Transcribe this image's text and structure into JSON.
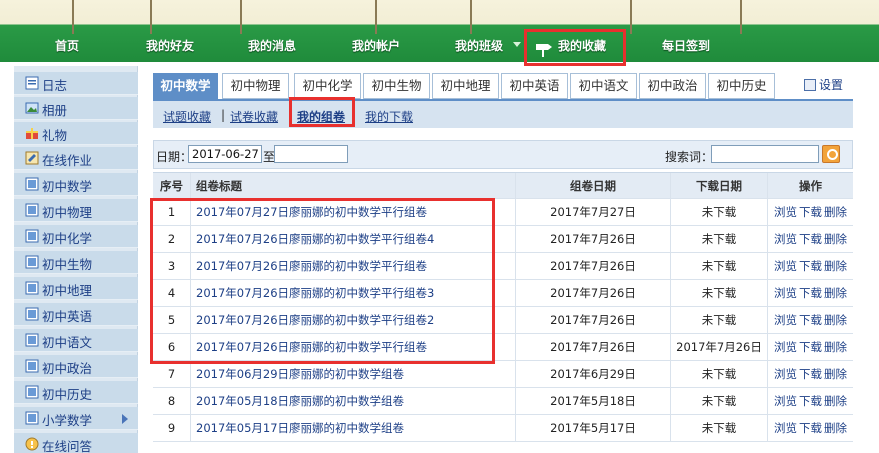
{
  "nav": {
    "items": [
      "首页",
      "我的好友",
      "我的消息",
      "我的帐户",
      "我的班级",
      "我的收藏",
      "每日签到"
    ],
    "active": "我的收藏"
  },
  "sidebar": {
    "items": [
      {
        "label": "日志",
        "icon": "journal-icon"
      },
      {
        "label": "相册",
        "icon": "photo-album-icon"
      },
      {
        "label": "礼物",
        "icon": "gift-icon"
      },
      {
        "label": "在线作业",
        "icon": "homework-icon"
      },
      {
        "label": "初中数学",
        "icon": "book-icon"
      },
      {
        "label": "初中物理",
        "icon": "book-icon"
      },
      {
        "label": "初中化学",
        "icon": "book-icon"
      },
      {
        "label": "初中生物",
        "icon": "book-icon"
      },
      {
        "label": "初中地理",
        "icon": "book-icon"
      },
      {
        "label": "初中英语",
        "icon": "book-icon"
      },
      {
        "label": "初中语文",
        "icon": "book-icon"
      },
      {
        "label": "初中政治",
        "icon": "book-icon"
      },
      {
        "label": "初中历史",
        "icon": "book-icon"
      },
      {
        "label": "小学数学",
        "icon": "book-icon"
      },
      {
        "label": "在线问答",
        "icon": "question-icon"
      }
    ]
  },
  "tabs": [
    "初中数学",
    "初中物理",
    "初中化学",
    "初中生物",
    "初中地理",
    "初中英语",
    "初中语文",
    "初中政治",
    "初中历史"
  ],
  "settings_label": "设置",
  "subnav": {
    "items": [
      "试题收藏",
      "试卷收藏",
      "我的组卷",
      "我的下载"
    ],
    "separator": "|"
  },
  "filter": {
    "date_label": "日期：",
    "date_from": "2017-06-27",
    "to_label": "至",
    "date_to": "",
    "search_label": "搜索词：",
    "search_value": ""
  },
  "table": {
    "headers": [
      "序号",
      "组卷标题",
      "组卷日期",
      "下载日期",
      "操作"
    ],
    "actions": [
      "浏览",
      "下载",
      "删除"
    ],
    "rows": [
      {
        "no": "1",
        "title": "2017年07月27日廖丽娜的初中数学平行组卷",
        "date": "2017年7月27日",
        "download": "未下载"
      },
      {
        "no": "2",
        "title": "2017年07月26日廖丽娜的初中数学平行组卷4",
        "date": "2017年7月26日",
        "download": "未下载"
      },
      {
        "no": "3",
        "title": "2017年07月26日廖丽娜的初中数学平行组卷",
        "date": "2017年7月26日",
        "download": "未下载"
      },
      {
        "no": "4",
        "title": "2017年07月26日廖丽娜的初中数学平行组卷3",
        "date": "2017年7月26日",
        "download": "未下载"
      },
      {
        "no": "5",
        "title": "2017年07月26日廖丽娜的初中数学平行组卷2",
        "date": "2017年7月26日",
        "download": "未下载"
      },
      {
        "no": "6",
        "title": "2017年07月26日廖丽娜的初中数学平行组卷",
        "date": "2017年7月26日",
        "download": "2017年7月26日"
      },
      {
        "no": "7",
        "title": "2017年06月29日廖丽娜的初中数学组卷",
        "date": "2017年6月29日",
        "download": "未下载"
      },
      {
        "no": "8",
        "title": "2017年05月18日廖丽娜的初中数学组卷",
        "date": "2017年5月18日",
        "download": "未下载"
      },
      {
        "no": "9",
        "title": "2017年05月17日廖丽娜的初中数学组卷",
        "date": "2017年5月17日",
        "download": "未下载"
      }
    ]
  },
  "colors": {
    "nav_green": "#1f8b3b",
    "tab_active": "#5e8ec7",
    "link_blue": "#1d3f86",
    "highlight_red": "#e8302e"
  }
}
